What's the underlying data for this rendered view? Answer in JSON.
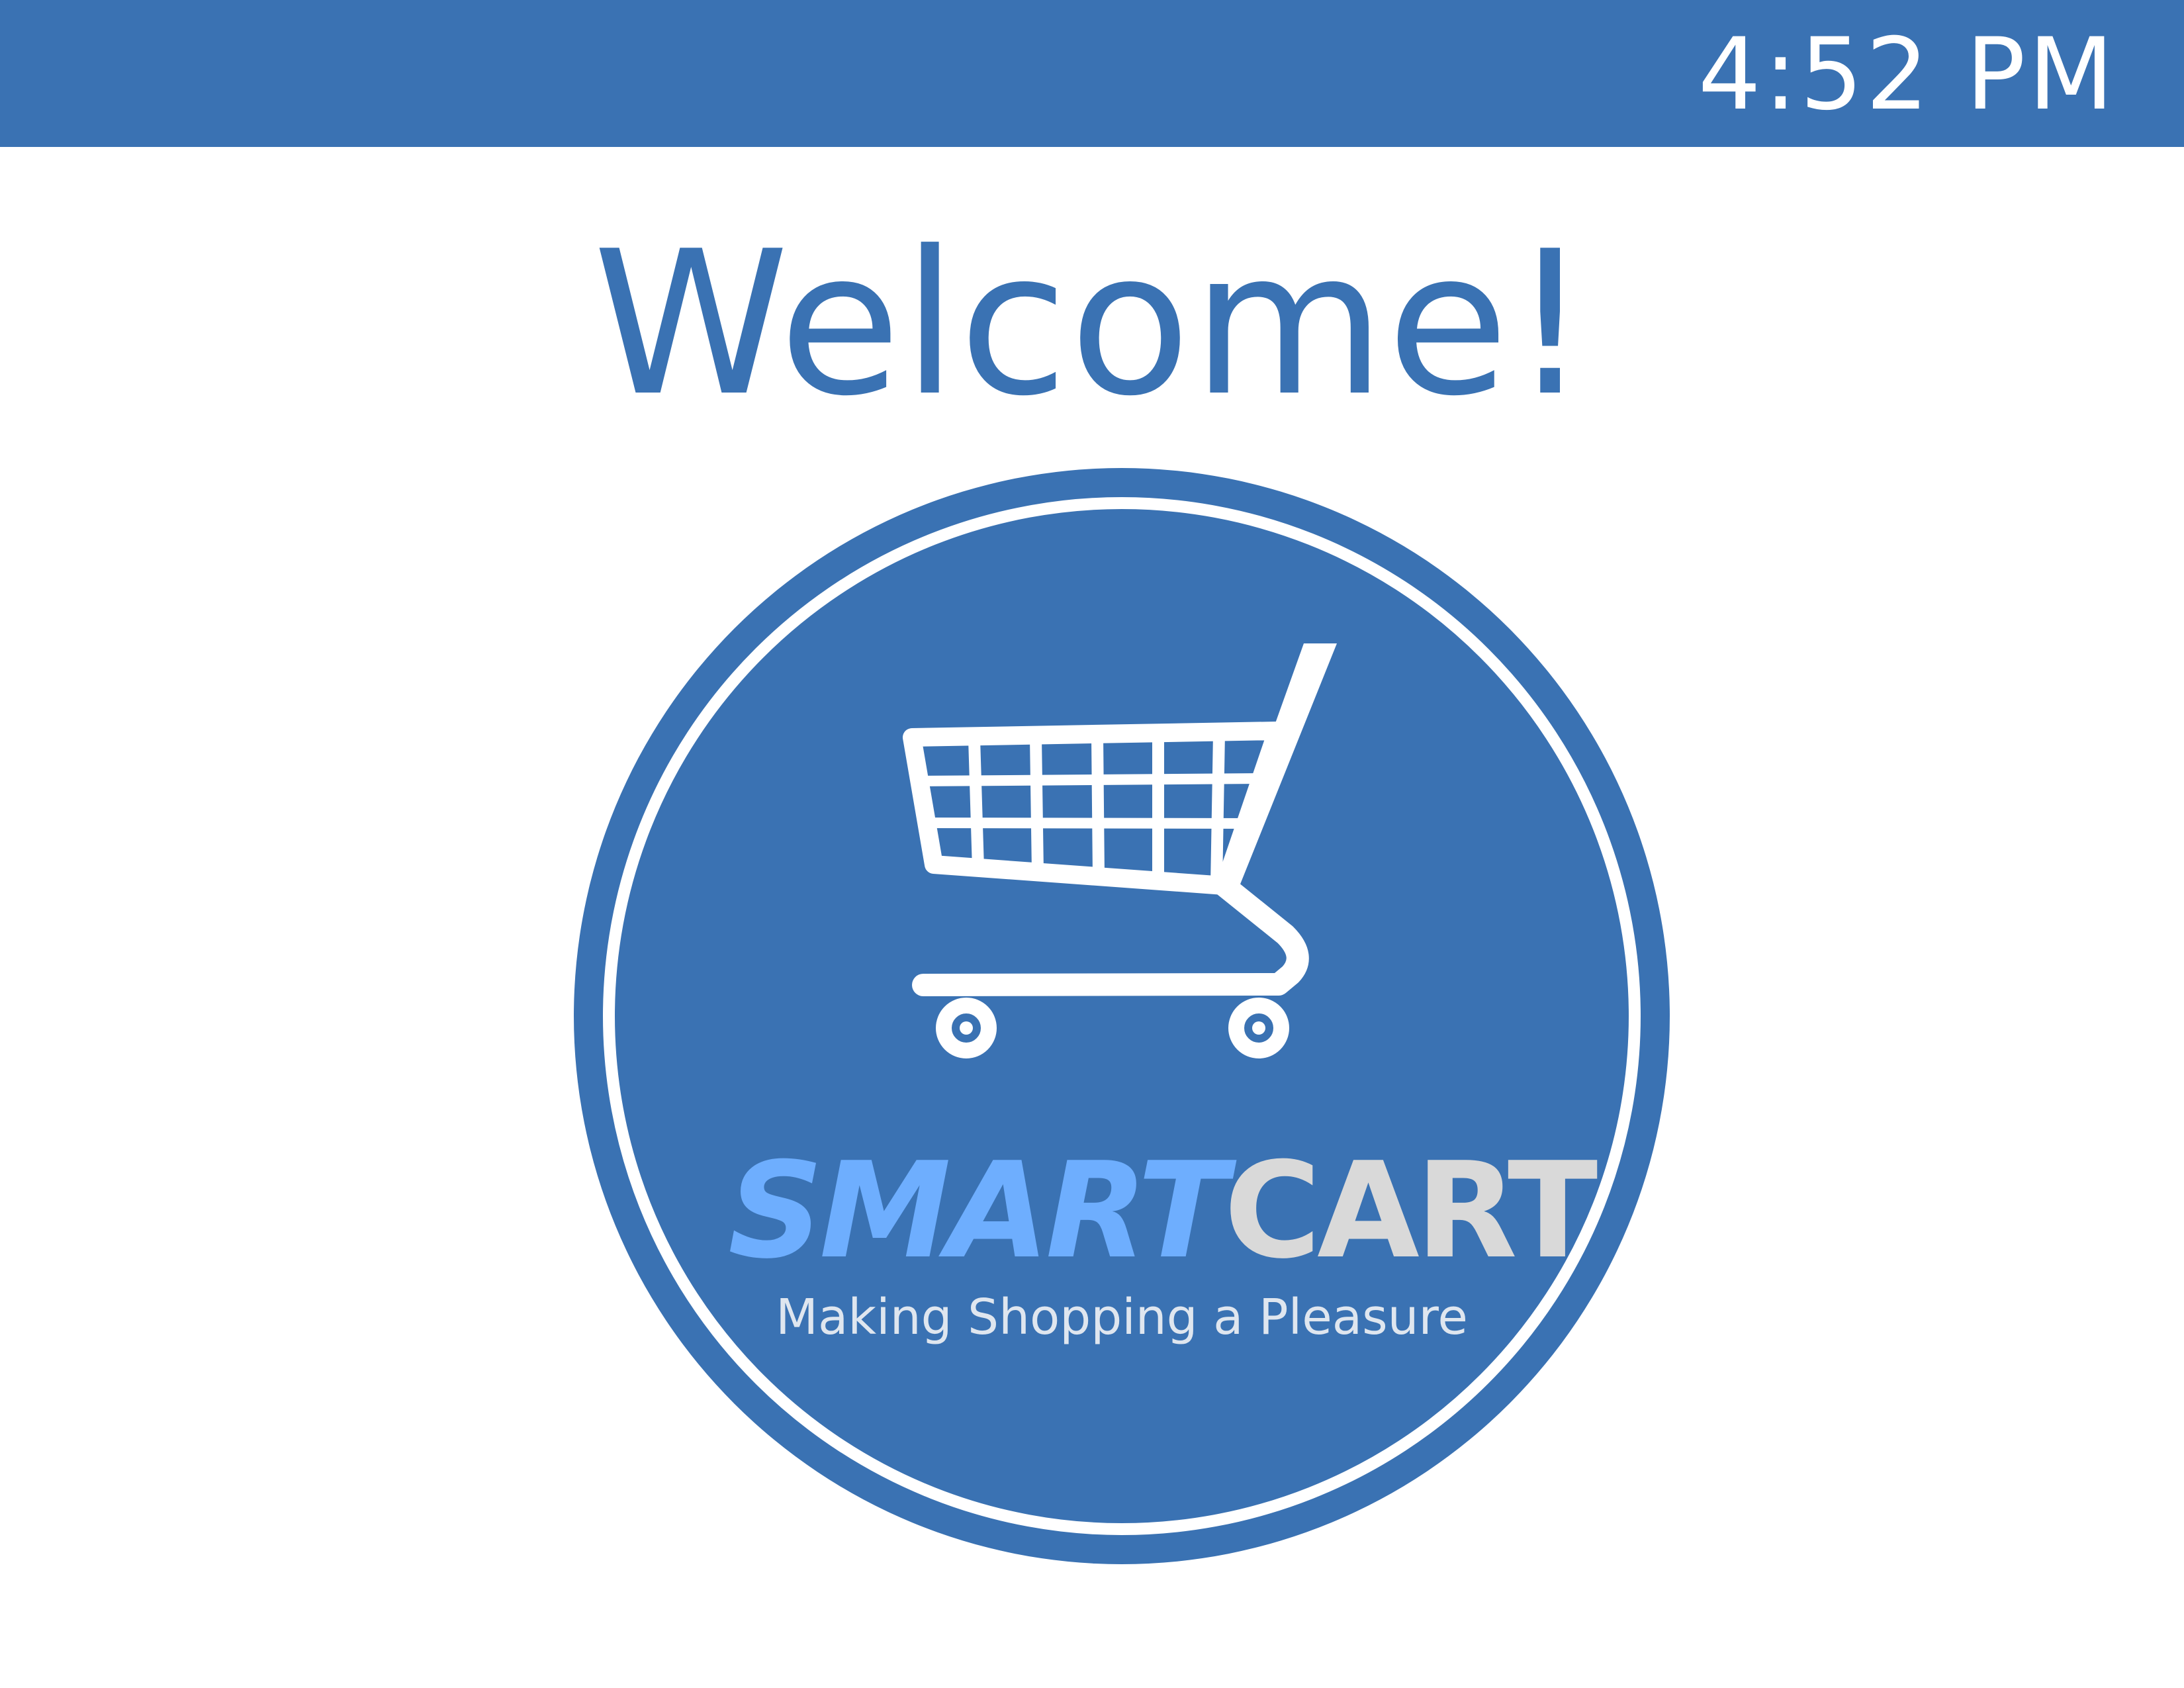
{
  "status_bar": {
    "time": "4:52 PM",
    "color": "#3a72b3"
  },
  "welcome": {
    "title": "Welcome!"
  },
  "logo": {
    "icon": "shopping-cart-icon",
    "brand_part1": "SMART",
    "brand_part2": "CART",
    "tagline": "Making Shopping a Pleasure",
    "circle_color": "#3a72b3",
    "smart_color": "#6eaefe",
    "cart_color": "#d9d9d9"
  }
}
